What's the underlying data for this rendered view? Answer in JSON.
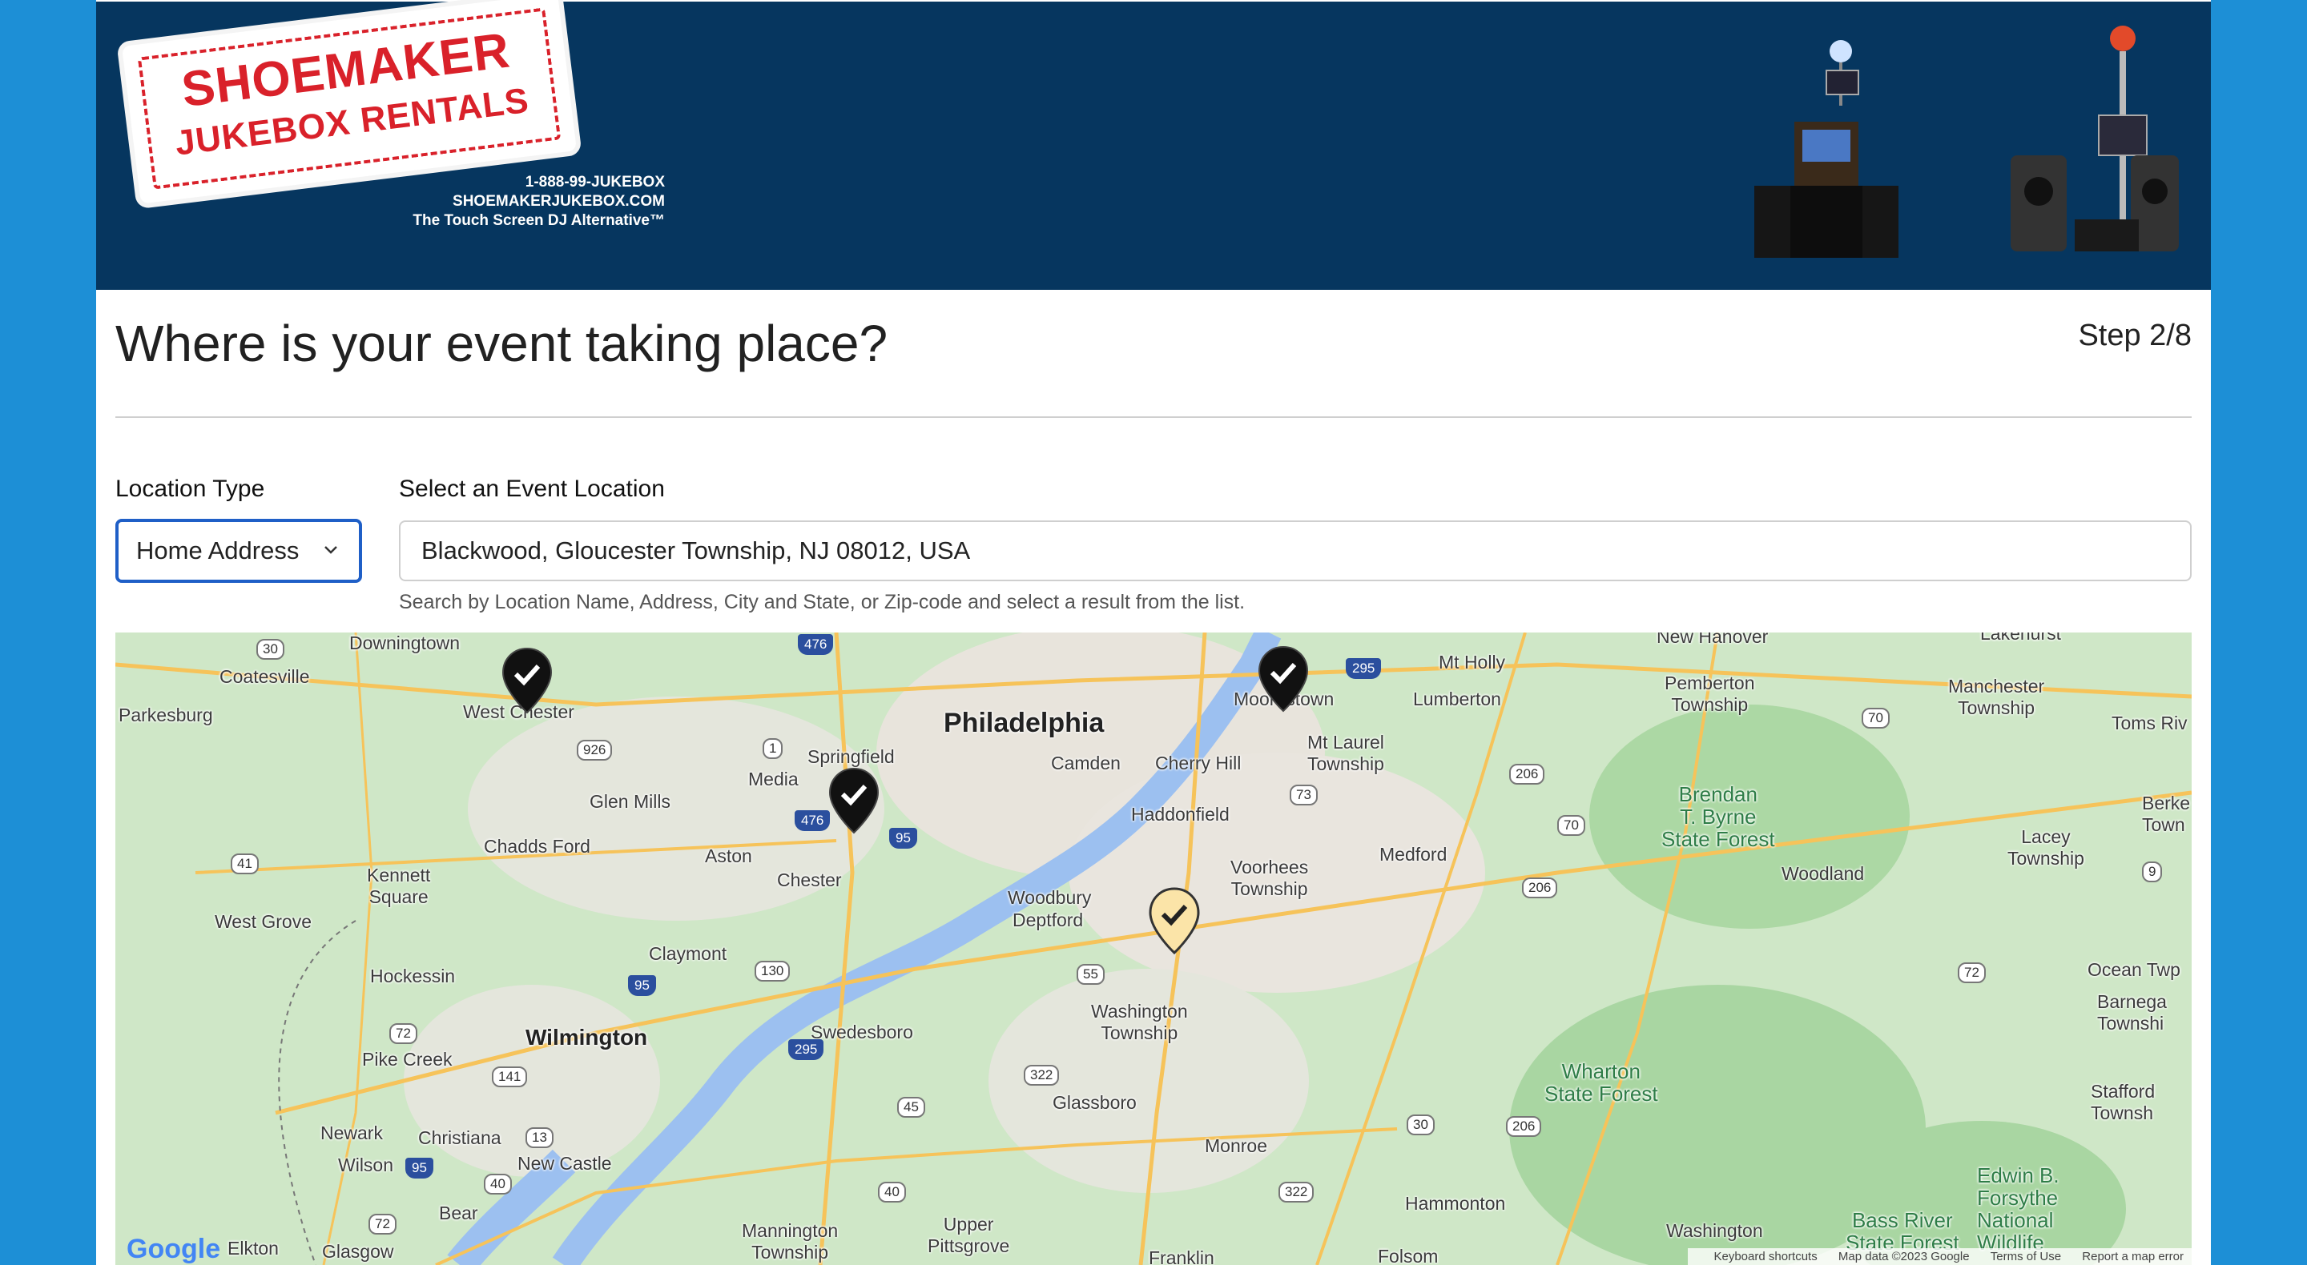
{
  "header": {
    "logo_line1": "SHOEMAKER",
    "logo_line2": "JUKEBOX RENTALS",
    "phone": "1-888-99-JUKEBOX",
    "website": "SHOEMAKERJUKEBOX.COM",
    "tagline": "The Touch Screen DJ Alternative™"
  },
  "form": {
    "title": "Where is your event taking place?",
    "step": "Step 2/8",
    "location_type_label": "Location Type",
    "location_type_value": "Home Address",
    "event_location_label": "Select an Event Location",
    "event_location_value": "Blackwood, Gloucester Township, NJ 08012, USA",
    "help_text": "Search by Location Name, Address, City and State, or Zip-code and select a result from the list."
  },
  "map": {
    "places": {
      "downingtown": "Downingtown",
      "coatesville": "Coatesville",
      "parkesburg": "Parkesburg",
      "west_chester": "West Chester",
      "glen_mills": "Glen Mills",
      "chadds_ford": "Chadds Ford",
      "kennett_square": "Kennett\nSquare",
      "west_grove": "West Grove",
      "hockessin": "Hockessin",
      "pike_creek": "Pike Creek",
      "newark": "Newark",
      "christiana": "Christiana",
      "wilson": "Wilson",
      "bear": "Bear",
      "elkton": "Elkton",
      "glasgow": "Glasgow",
      "new_castle": "New Castle",
      "wilmington": "Wilmington",
      "claymont": "Claymont",
      "chester": "Chester",
      "aston": "Aston",
      "media": "Media",
      "springfield": "Springfield",
      "philadelphia": "Philadelphia",
      "camden": "Camden",
      "cherry_hill": "Cherry Hill",
      "haddonfield": "Haddonfield",
      "voorhees": "Voorhees\nTownship",
      "woodbury": "Woodbury",
      "deptford": "Deptford",
      "swedesboro": "Swedesboro",
      "washington_twp": "Washington\nTownship",
      "glassboro": "Glassboro",
      "monroe": "Monroe",
      "mannington": "Mannington\nTownship",
      "upper_pittsgrove": "Upper\nPittsgrove",
      "franklin": "Franklin",
      "moorestown": "Moorestown",
      "mt_laurel": "Mt Laurel\nTownship",
      "mt_holly": "Mt Holly",
      "lumberton": "Lumberton",
      "medford": "Medford",
      "new_hanover": "New Hanover",
      "pemberton": "Pemberton\nTownship",
      "manchester": "Manchester\nTownship",
      "lakehurst": "Lakehurst",
      "toms_river": "Toms Riv",
      "berkeley": "Berke\nTown",
      "lacey": "Lacey\nTownship",
      "woodland": "Woodland",
      "ocean_twp": "Ocean Twp",
      "barnegat": "Barnega\nTownshi",
      "stafford": "Stafford\nTownsh",
      "hammonton": "Hammonton",
      "folsom": "Folsom",
      "washington2": "Washington",
      "edwin_b": "Edwin B.\nForsythe\nNational\nWildlife",
      "bass_river": "Bass River\nState Forest",
      "wharton": "Wharton\nState Forest",
      "brendan": "Brendan\nT. Byrne\nState Forest"
    },
    "routes": [
      "30",
      "476",
      "295",
      "1",
      "926",
      "476",
      "95",
      "41",
      "130",
      "95",
      "295",
      "55",
      "322",
      "45",
      "72",
      "141",
      "13",
      "95",
      "40",
      "72",
      "40",
      "322",
      "30",
      "206",
      "73",
      "70",
      "206",
      "70",
      "206",
      "72",
      "9"
    ],
    "attribution": {
      "shortcuts": "Keyboard shortcuts",
      "map_data": "Map data ©2023 Google",
      "terms": "Terms of Use",
      "report": "Report a map error"
    },
    "google_label": "Google"
  }
}
